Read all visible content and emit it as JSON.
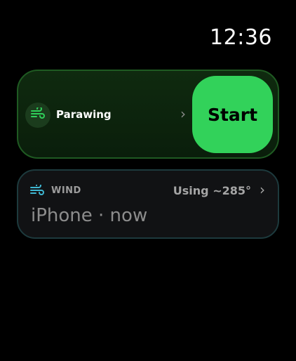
{
  "status_bar": {
    "time": "12:36"
  },
  "workout": {
    "activity_icon": "wind-icon",
    "activity_label": "Parawing",
    "chevron": "›",
    "start_label": "Start",
    "colors": {
      "start_bg": "#32d25a",
      "icon_color": "#2fd05a"
    }
  },
  "wind": {
    "icon": "wind-icon",
    "title": "WIND",
    "status": "Using ~285°",
    "chevron": "›",
    "subtitle": "iPhone · now",
    "colors": {
      "icon_color": "#3fb7d2"
    }
  }
}
